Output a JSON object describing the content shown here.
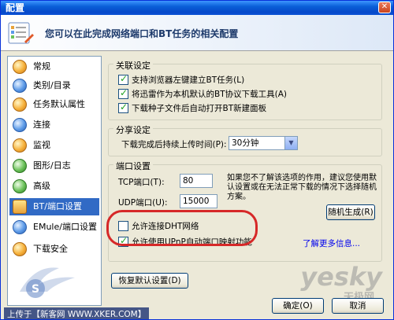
{
  "window": {
    "title": "配置"
  },
  "header": {
    "text": "您可以在此完成网络端口和BT任务的相关配置"
  },
  "sidebar": {
    "items": [
      {
        "label": "常规",
        "icon": "orange-globe-icon"
      },
      {
        "label": "类别/目录",
        "icon": "folder-globe-icon"
      },
      {
        "label": "任务默认属性",
        "icon": "task-icon"
      },
      {
        "label": "连接",
        "icon": "connection-icon"
      },
      {
        "label": "监视",
        "icon": "monitor-icon"
      },
      {
        "label": "图形/日志",
        "icon": "chart-icon"
      },
      {
        "label": "高级",
        "icon": "advanced-icon"
      },
      {
        "label": "BT/端口设置",
        "icon": "bt-icon",
        "selected": true
      },
      {
        "label": "EMule/端口设置",
        "icon": "emule-icon"
      },
      {
        "label": "下载安全",
        "icon": "security-icon"
      }
    ]
  },
  "association": {
    "legend": "关联设定",
    "options": [
      {
        "label": "支持浏览器左键建立BT任务(L)",
        "checked": true
      },
      {
        "label": "将迅雷作为本机默认的BT协议下载工具(A)",
        "checked": true
      },
      {
        "label": "下载种子文件后自动打开BT新建面板",
        "checked": true
      }
    ]
  },
  "share": {
    "legend": "分享设定",
    "label": "下载完成后持续上传时间(P):",
    "value": "30分钟"
  },
  "port": {
    "legend": "端口设置",
    "tcp_label": "TCP端口(T):",
    "tcp_value": "80",
    "udp_label": "UDP端口(U):",
    "udp_value": "15000",
    "hint": "如果您不了解该选项的作用，建议您使用默认设置或在无法正常下载的情况下选择随机方案。",
    "random_button": "随机生成(R)",
    "allow_dht": "允许连接DHT网络",
    "allow_upnp": "允许使用UPnP自动端口映射功能",
    "learn_more": "了解更多信息..."
  },
  "buttons": {
    "restore": "恢复默认设置(D)",
    "ok": "确定(O)",
    "cancel": "取消"
  },
  "footer": {
    "text": "上传于【新客网 WWW.XKER.COM】"
  },
  "watermark": {
    "text": "yesky",
    "sub": "天极网"
  },
  "colors": {
    "accent": "#316ac5",
    "highlight": "#d62828",
    "link": "#0000ee"
  }
}
